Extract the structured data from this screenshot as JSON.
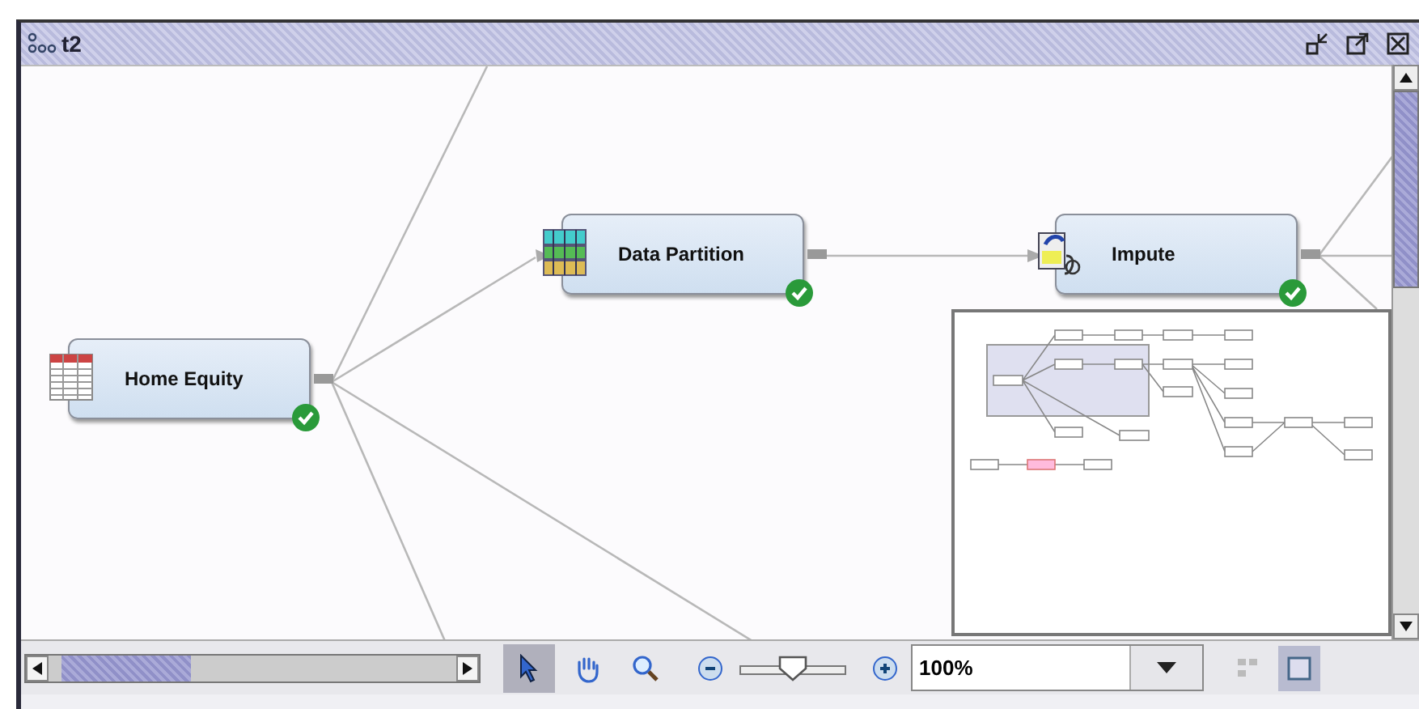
{
  "window": {
    "title": "t2"
  },
  "nodes": [
    {
      "label": "Home Equity",
      "kind": "table",
      "completed": true
    },
    {
      "label": "Data Partition",
      "kind": "partition",
      "completed": true
    },
    {
      "label": "Impute",
      "kind": "impute",
      "completed": true
    }
  ],
  "overview": {
    "shown": true
  },
  "toolbar": {
    "tools": [
      {
        "kind": "pointer",
        "selected": true
      },
      {
        "kind": "pan",
        "selected": false
      },
      {
        "kind": "zoom",
        "selected": false
      }
    ],
    "zoom_slider": {
      "level": 0.5
    },
    "zoom_value": "100%",
    "view_modes": [
      {
        "kind": "grid",
        "selected": false
      },
      {
        "kind": "overview",
        "selected": true
      }
    ]
  }
}
